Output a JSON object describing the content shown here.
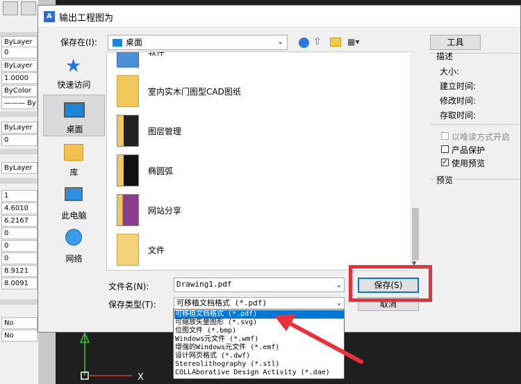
{
  "left_panel": {
    "cells": [
      "ByLayer",
      "0",
      "ByLayer",
      "1.0000",
      "ByColor",
      "——— ByL",
      "ByLayer",
      "0",
      "ByLayer",
      "1",
      "4.6010",
      "6.2167",
      "0",
      "0",
      "0",
      "8.9121",
      "8.0091",
      "No",
      "No"
    ]
  },
  "dialog": {
    "title": "输出工程图为",
    "save_in_label": "保存在(I):",
    "save_in_value": "桌面",
    "tools_label": "工具",
    "places": [
      "快速访问",
      "桌面",
      "库",
      "此电脑",
      "网络"
    ],
    "files": [
      "软件",
      "室内实木门图型CAD图纸",
      "图层管理",
      "椭圆弧",
      "网站分享",
      "文件"
    ],
    "filename_label": "文件名(N):",
    "filename_value": "Drawing1.pdf",
    "filetype_label": "保存类型(T):",
    "filetype_value": "可移植文档格式 (*.pdf)",
    "save_button": "保存(S)",
    "cancel_button": "取消",
    "description": {
      "title": "描述",
      "size": "大小:",
      "created": "建立时间:",
      "modified": "修改时间:",
      "accessed": "存取时间:"
    },
    "options": {
      "readonly": "以唯读方式开启",
      "protect": "产品保护",
      "use_preview": "使用预览"
    },
    "preview_label": "预览",
    "filetype_options": [
      "可移植文档格式 (*.pdf)",
      "可缩放矢量图形 (*.svg)",
      "位图文件 (*.bmp)",
      "Windows元文件 (*.wmf)",
      "增强的Windows元文件 (*.emf)",
      "设计网页格式 (*.dwf)",
      "Stereolithography (*.stl)",
      "COLLAborative Design Activity (*.dae)"
    ]
  },
  "colors": {
    "highlight": "#0078d7",
    "annotation_red": "#e8313a",
    "ucs_green": "#39c63c"
  }
}
